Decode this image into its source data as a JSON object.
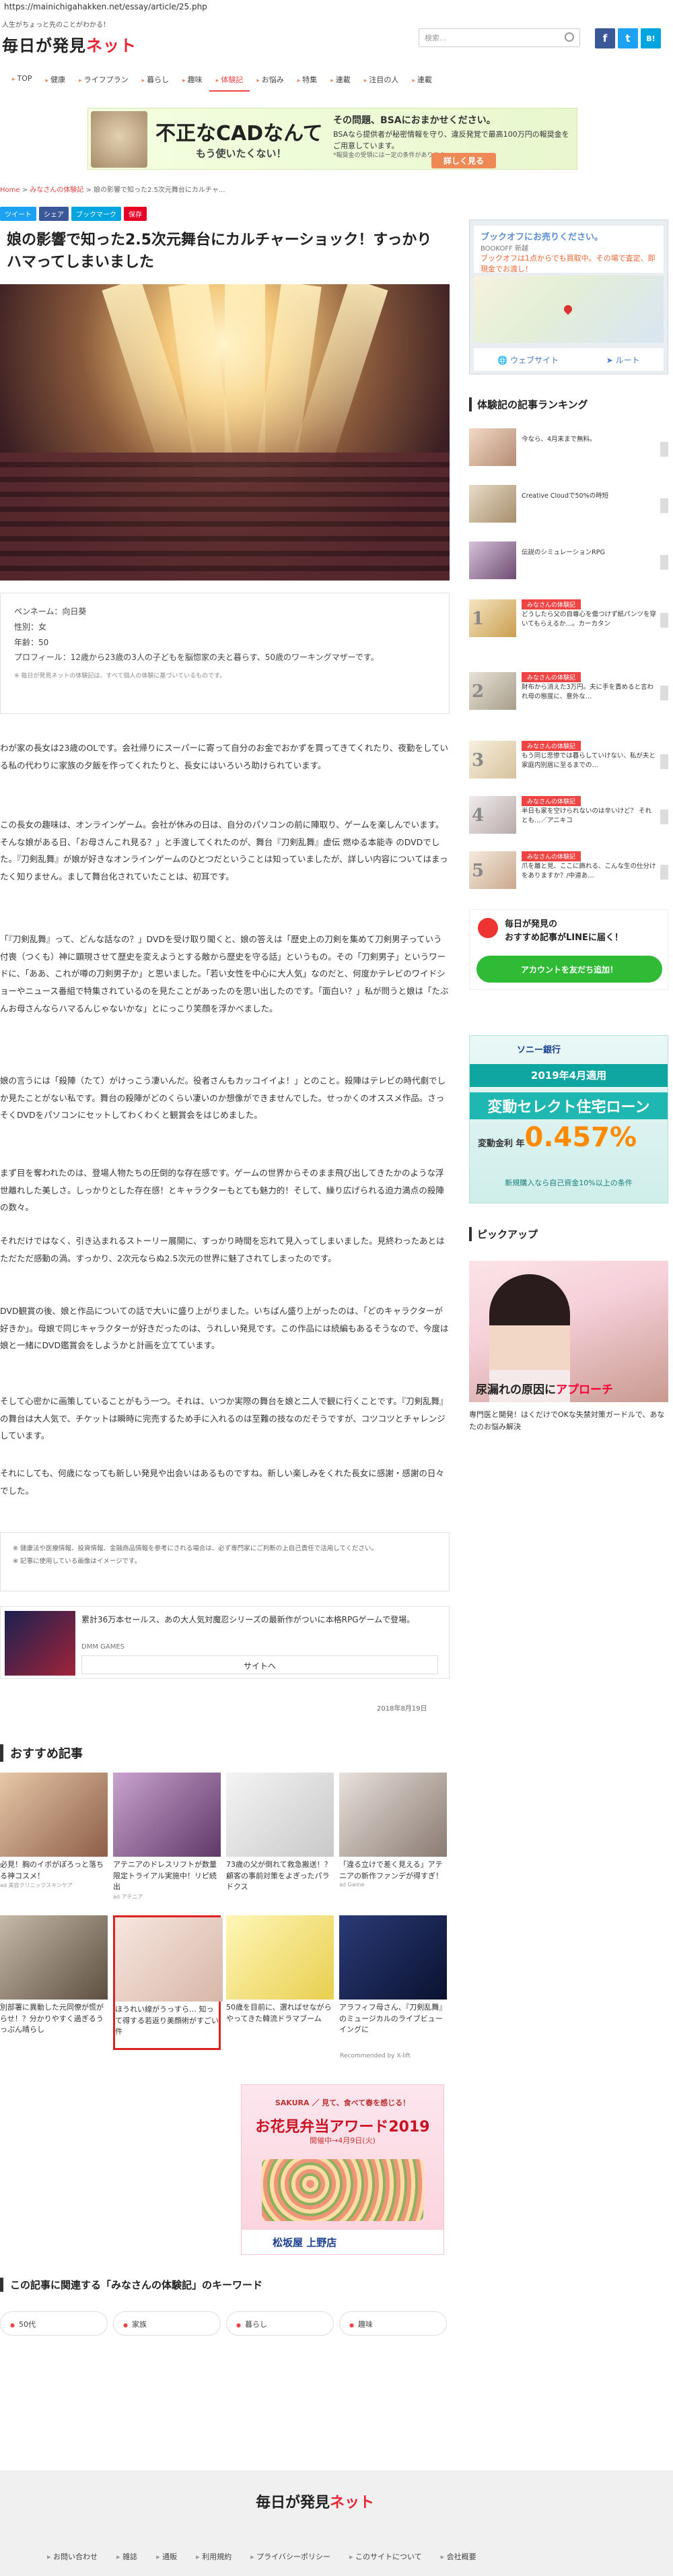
{
  "url": "https://mainichigahakken.net/essay/article/25.php",
  "site": {
    "tagline": "人生がちょっと先のことがわかる！",
    "logo_main": "毎日が発見",
    "logo_accent": "ネット",
    "search_placeholder": "検索..."
  },
  "social_top": [
    "f",
    "t",
    "B!"
  ],
  "nav": [
    {
      "label": "TOP",
      "active": false
    },
    {
      "label": "健康",
      "active": false
    },
    {
      "label": "ライフプラン",
      "active": false
    },
    {
      "label": "暮らし",
      "active": false
    },
    {
      "label": "趣味",
      "active": false
    },
    {
      "label": "体験記",
      "active": true
    },
    {
      "label": "お悩み",
      "active": false
    },
    {
      "label": "特集",
      "active": false
    },
    {
      "label": "連載",
      "active": false
    },
    {
      "label": "注目の人",
      "active": false
    },
    {
      "label": "連載",
      "active": false
    }
  ],
  "ad_top": {
    "main": "不正なCADなんて",
    "sub": "もう使いたくない！",
    "right_head": "その問題、BSAにおまかせください。",
    "right_body": "BSAなら提供者が秘密情報を守り、違反発覚で最高100万円の報奨金をご用意しています。",
    "note": "*報奨金の受領には一定の条件があります。",
    "cta": "詳しく見る"
  },
  "breadcrumb": [
    "Home",
    "みなさんの体験記",
    "娘の影響で知った2.5次元舞台にカルチャ..."
  ],
  "share_buttons": [
    {
      "label": "ツイート",
      "color": "#1da1f2"
    },
    {
      "label": "シェア",
      "color": "#3b5998"
    },
    {
      "label": "ブックマーク",
      "color": "#00a4de"
    },
    {
      "label": "保存",
      "color": "#e60023"
    }
  ],
  "article": {
    "title": "娘の影響で知った2.5次元舞台にカルチャーショック！すっかりハマってしまいました",
    "profile": [
      "ペンネーム：向日葵",
      "性別：女",
      "年齢：50",
      "プロフィール：12歳から23歳の3人の子どもを脳惚家の夫と暮らす、50歳のワーキングマザーです。"
    ],
    "profile_note": "※ 毎日が発見ネットの体験記は、すべて個人の体験に基づいているものです。",
    "paragraphs": [
      "わが家の長女は23歳のOLです。会社帰りにスーパーに寄って自分のお金でおかずを買ってきてくれたり、夜勤をしている私の代わりに家族の夕飯を作ってくれたりと、長女にはいろいろ助けられています。",
      "この長女の趣味は、オンラインゲーム。会社が休みの日は、自分のパソコンの前に陣取り、ゲームを楽しんでいます。そんな娘がある日、「お母さんこれ見る？」と手渡してくれたのが、舞台『刀剣乱舞』虚伝 燃ゆる本能寺 のDVDでした。『刀剣乱舞』が娘が好きなオンラインゲームのひとつだということは知っていましたが、詳しい内容についてはまったく知りません。まして舞台化されていたことは、初耳です。",
      "「『刀剣乱舞』って、どんな話なの？」DVDを受け取り聞くと、娘の答えは「歴史上の刀剣を集めて刀剣男子っていう付喪（つくも）神に顕現させて歴史を変えようとする敵から歴史を守る話」というもの。その「刀剣男子」というワードに、「ああ、これが噂の刀剣男子か」と思いました。「若い女性を中心に大人気」なのだと、何度かテレビのワイドショーやニュース番組で特集されているのを見たことがあったのを思い出したのです。「面白い？」私が問うと娘は「たぶんお母さんならハマるんじゃないかな」とにっこり笑顔を浮かべました。",
      "娘の言うには「殺陣（たて）がけっこう凄いんだ。役者さんもカッコイイよ！」とのこと。殺陣はテレビの時代劇でしか見たことがない私です。舞台の殺陣がどのくらい凄いのか想像ができませんでした。せっかくのオススメ作品。さっそくDVDをパソコンにセットしてわくわくと観賞会をはじめました。",
      "まず目を奪われたのは、登場人物たちの圧倒的な存在感です。ゲームの世界からそのまま飛び出してきたかのような浮世離れした美しさ。しっかりとした存在感！とキャラクターもとても魅力的！そして、繰り広げられる迫力満点の殺陣の数々。",
      "それだけではなく、引き込まれるストーリー展開に、すっかり時間を忘れて見入ってしまいました。見終わったあとはただただ感動の渦。すっかり、2次元ならぬ2.5次元の世界に魅了されてしまったのです。",
      "DVD観賞の後、娘と作品についての話で大いに盛り上がりました。いちばん盛り上がったのは、「どのキャラクターが好きか」。母娘で同じキャラクターが好きだったのは、うれしい発見です。この作品には続編もあるそうなので、今度は娘と一緒にDVD鑑賞会をしようかと計画を立てています。",
      "そして心密かに画策していることがもう一つ。それは、いつか実際の舞台を娘と二人で観に行くことです。『刀剣乱舞』の舞台は大人気で、チケットは瞬時に完売するため手に入れるのは至難の技なのだそうですが、コツコツとチャレンジしています。",
      "それにしても、何歳になっても新しい発見や出会いはあるものですね。新しい楽しみをくれた長女に感謝・感謝の日々でした。"
    ],
    "disclaimer": [
      "健康法や医療情報、投資情報、金融商品情報を参考にされる場合は、必ず専門家にご判断の上自己責任で活用してください。",
      "記事に使用している画像はイメージです。"
    ],
    "date": "2018年8月19日"
  },
  "dmm_ad": {
    "text": "累計36万本セールス、あの大人気対魔忍シリーズの最新作がついに本格RPGゲームで登場。",
    "source": "DMM GAMES",
    "button": "サイトへ"
  },
  "recommended": {
    "title": "おすすめ記事",
    "items": [
      {
        "caption": "必見！胸のイボがぽろっと落ちる神コスメ！",
        "source": "ad 美容クリニックスキンケア",
        "c1": "#e8c7a8",
        "c2": "#8c5f48",
        "highlight": false
      },
      {
        "caption": "アテニアのドレスリフトが数量限定トライアル実施中！リピ続出",
        "source": "ad アテニア",
        "c1": "#caa4cf",
        "c2": "#5f3868",
        "highlight": false
      },
      {
        "caption": "73歳の父が倒れて救急搬送！？ 顧客の事前対策をよぎったパラドクス",
        "source": "",
        "c1": "#f4f4f4",
        "c2": "#c9c9c9",
        "highlight": false
      },
      {
        "caption": "「違る立けで差く見える」アテニアの新作ファンデが得すぎ！",
        "source": "ad Gwine",
        "c1": "#e9e1dc",
        "c2": "#8a7b72",
        "highlight": false
      },
      {
        "caption": "別部署に異動した元同僚が慌がらせ！？分かりやすく過ぎるうっぷん晴らし",
        "source": "",
        "c1": "#c7b9a8",
        "c2": "#5e5040",
        "highlight": false
      },
      {
        "caption": "ほうれい線がうっすら… 知って得する若返り美顔術がすごい件",
        "source": "",
        "c1": "#f7e6df",
        "c2": "#d8b7a9",
        "highlight": true
      },
      {
        "caption": "50歳を目前に、選ればせながらやってきた韓流ドラマブーム",
        "source": "",
        "c1": "#fff6b8",
        "c2": "#e8cf4f",
        "highlight": false
      },
      {
        "caption": "アラフィフ母さん、『刀剣乱舞』のミュージカルのライブビューイングに",
        "source": "",
        "c1": "#2a3a77",
        "c2": "#0b1230",
        "highlight": false
      }
    ],
    "recommended_by": "Recommended by X-lift"
  },
  "ad_sakura": {
    "brand": "SAKURA",
    "line1": "見て、食べて春を感じる！",
    "line2": "お花見弁当アワード2019",
    "line3": "開催中→4月9日(火)",
    "footer": "松坂屋 上野店"
  },
  "keywords": {
    "title": "この記事に関連する「みなさんの体験記」のキーワード",
    "items": [
      "50代",
      "家族",
      "暮らし",
      "趣味"
    ]
  },
  "footer": {
    "logo_main": "毎日が発見",
    "logo_accent": "ネット",
    "links": [
      "お問い合わせ",
      "雑誌",
      "通販",
      "利用規約",
      "プライバシーポリシー",
      "このサイトについて",
      "会社概要"
    ]
  },
  "sidebar": {
    "map": {
      "title": "ブックオフにお売りください。",
      "sub": "BOOKOFF 新越",
      "body": "ブックオフは1点からでも買取中。その場で査定、即現金でお渡し！",
      "btn1": "ウェブサイト",
      "btn2": "ルート"
    },
    "ranking_title": "体験記の記事ランキング",
    "ranking": [
      {
        "num": "",
        "category": "",
        "text": "今なら、4月末まで無料。",
        "c1": "#f2d9c6",
        "c2": "#b68b73"
      },
      {
        "num": "",
        "category": "",
        "text": "Creative Cloudで50%の時短",
        "c1": "#e7dcc9",
        "c2": "#a88e6c"
      },
      {
        "num": "",
        "category": "",
        "text": "伝説のシミュレーションRPG",
        "c1": "#d5c2d8",
        "c2": "#6f4c73"
      },
      {
        "num": "1",
        "category": "みなさんの体験記",
        "text": "どうしたら父の自尊心を傷つけず紙パンツを穿いてもらえるか…。カーカタン",
        "c1": "#f6e5c2",
        "c2": "#c99e4f"
      },
      {
        "num": "2",
        "category": "みなさんの体験記",
        "text": "財布から消えた3万円。夫に手を責めると言われ母の態度に、意外な…",
        "c1": "#e7e2d8",
        "c2": "#a89e8a"
      },
      {
        "num": "3",
        "category": "みなさんの体験記",
        "text": "もう同じ悲惨では暮らしていけない、私が夫と家庭内別居に至るまでの…",
        "c1": "#f7efe0",
        "c2": "#d7c29a"
      },
      {
        "num": "4",
        "category": "みなさんの体験記",
        "text": "半日も家を空けられないのは辛いけど？ それとも…／アニキコ",
        "c1": "#f0ecec",
        "c2": "#b8aaaa"
      },
      {
        "num": "5",
        "category": "みなさんの体験記",
        "text": "爪を離と見、ここに飾れる、こんな生の仕分けをありますか？/中道あ…",
        "c1": "#f5eadf",
        "c2": "#c8a88b"
      }
    ],
    "line": {
      "title_l1": "毎日が発見の",
      "title_l2": "おすすめ記事がLINEに届く！",
      "button": "アカウントを友だち追加！"
    },
    "sony": {
      "brand": "ソニー銀行",
      "band": "2019年4月適用",
      "headline": "変動セレクト住宅ローン",
      "label": "変動金利 年",
      "rate": "0.457%",
      "foot": "新規購入なら自己資金10%以上の条件"
    },
    "pickup_title": "ピックアップ",
    "pickup_cap_a": "尿漏れの原因に",
    "pickup_cap_b": "アプローチ",
    "pickup_text": "専門医と開発！はくだけでOKな失禁対策ガードルで、あなたのお悩み解決"
  }
}
